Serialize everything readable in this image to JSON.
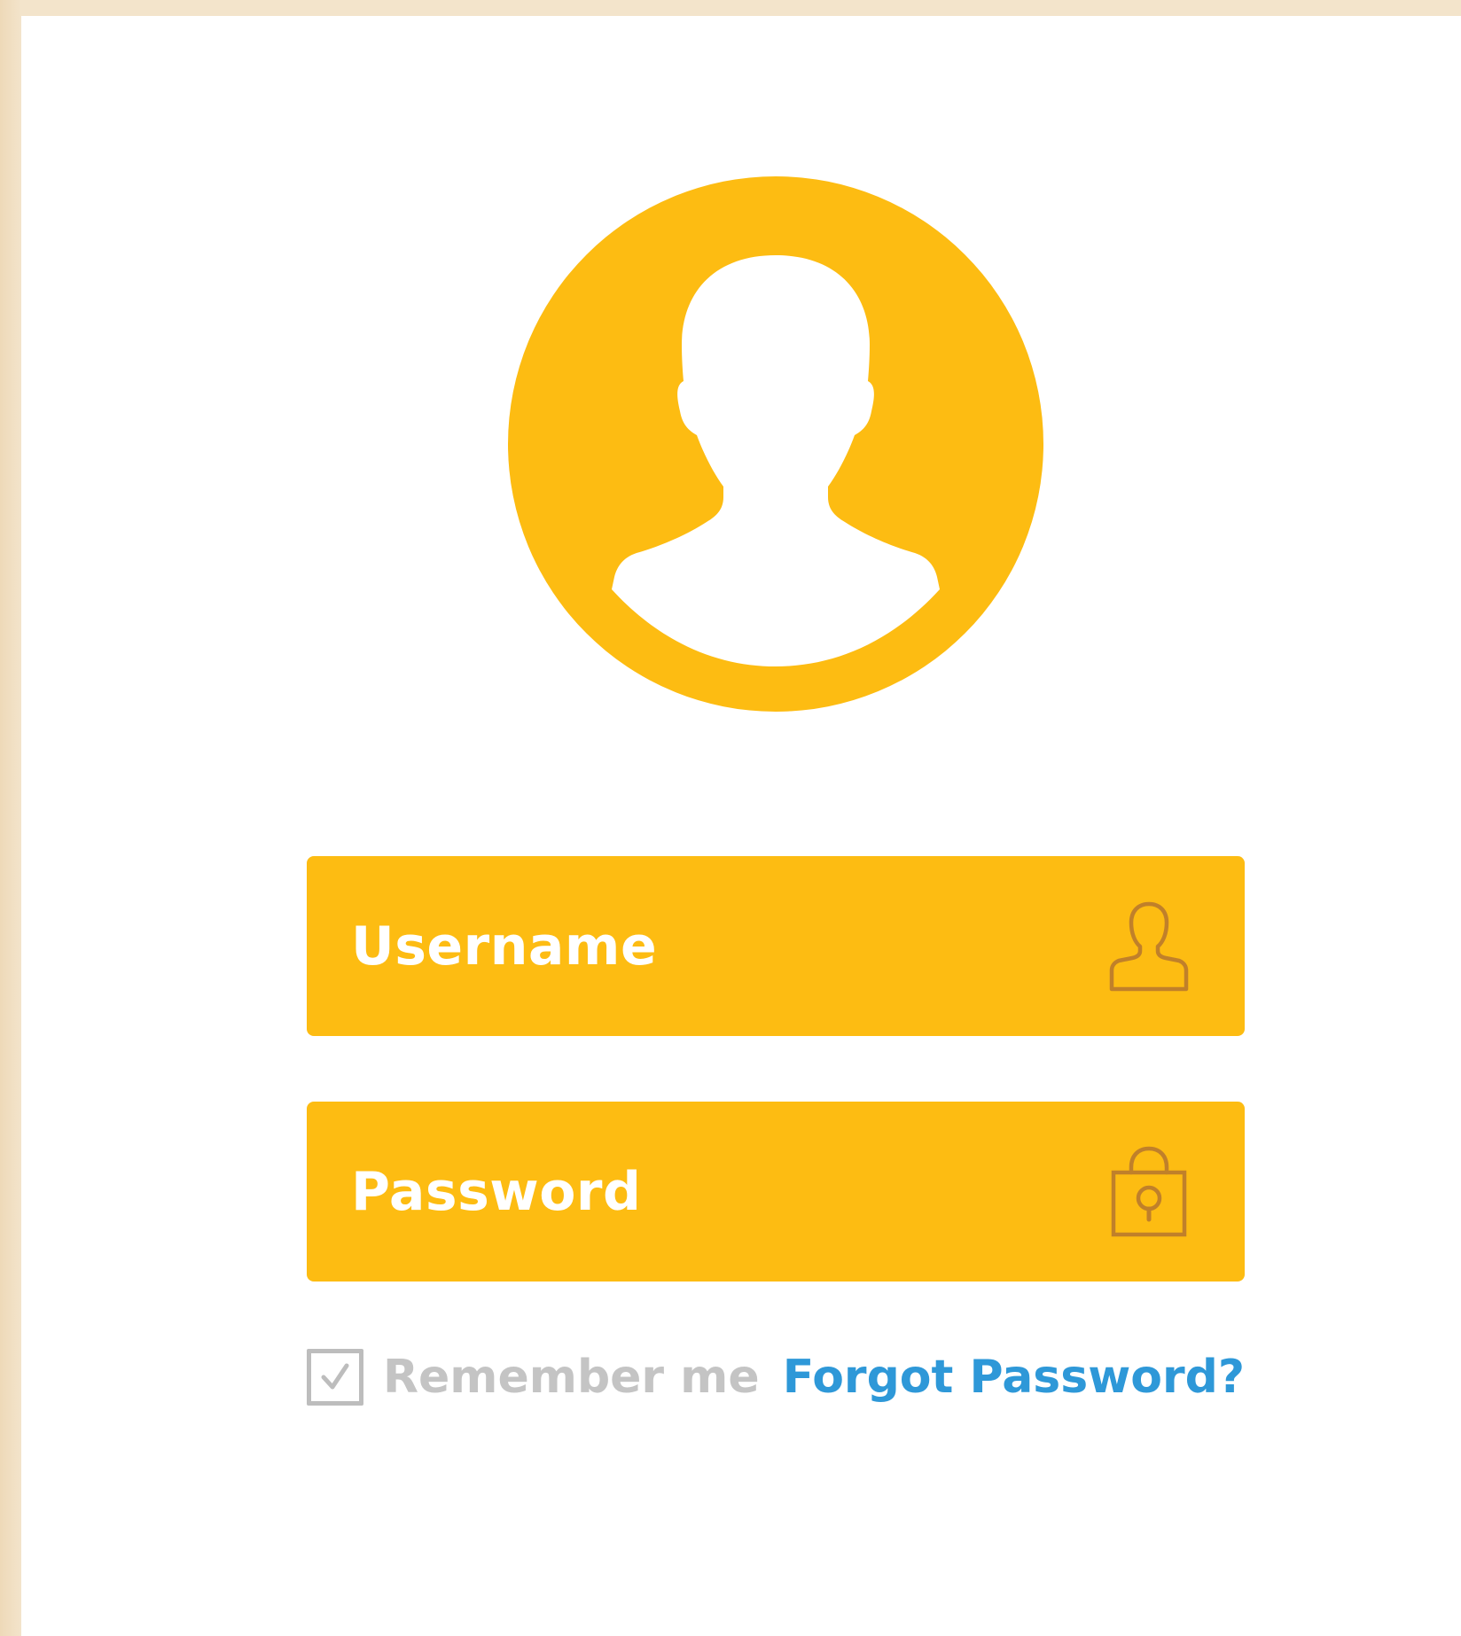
{
  "theme": {
    "accent": "#FDBC12",
    "icon_stroke": "#C0802A",
    "link": "#2E98D8",
    "muted": "#BDBDBD",
    "card_background": "#FFFFFF",
    "page_background": "#F3E4CB"
  },
  "avatar": {
    "icon": "user-silhouette-icon"
  },
  "form": {
    "username": {
      "placeholder": "Username",
      "value": "",
      "icon": "user-outline-icon"
    },
    "password": {
      "placeholder": "Password",
      "value": "",
      "icon": "lock-icon"
    },
    "remember_me": {
      "label": "Remember me",
      "checked": true,
      "icon": "check-icon"
    },
    "forgot_password": {
      "label": "Forgot Password?"
    }
  }
}
